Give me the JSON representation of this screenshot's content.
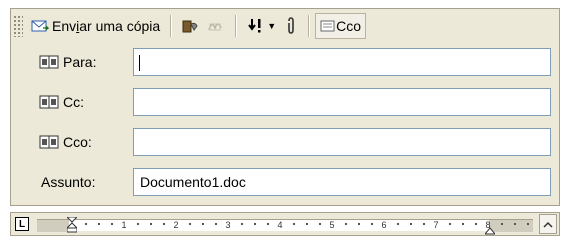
{
  "toolbar": {
    "send_copy_label_pre": "Env",
    "send_copy_label_u": "i",
    "send_copy_label_post": "ar uma cópia",
    "cco_label": "Cco",
    "icons": [
      "send-copy-icon",
      "address-book-icon",
      "signature-icon",
      "importance-icon",
      "attach-icon",
      "bcc-icon"
    ]
  },
  "fields": {
    "para_label": "Para:",
    "para_value": "",
    "cc_label": "Cc:",
    "cc_value": "",
    "cco_label": "Cco:",
    "cco_value": "",
    "assunto_label": "Assunto:",
    "assunto_value": "Documento1.doc"
  },
  "ruler": {
    "tab_selector": "L",
    "numbers": [
      "1",
      "2",
      "3",
      "4",
      "5",
      "6",
      "7",
      "8"
    ]
  },
  "colors": {
    "chrome": "#ece9d8",
    "border": "#a7a08f",
    "input_border": "#7f9db9"
  }
}
